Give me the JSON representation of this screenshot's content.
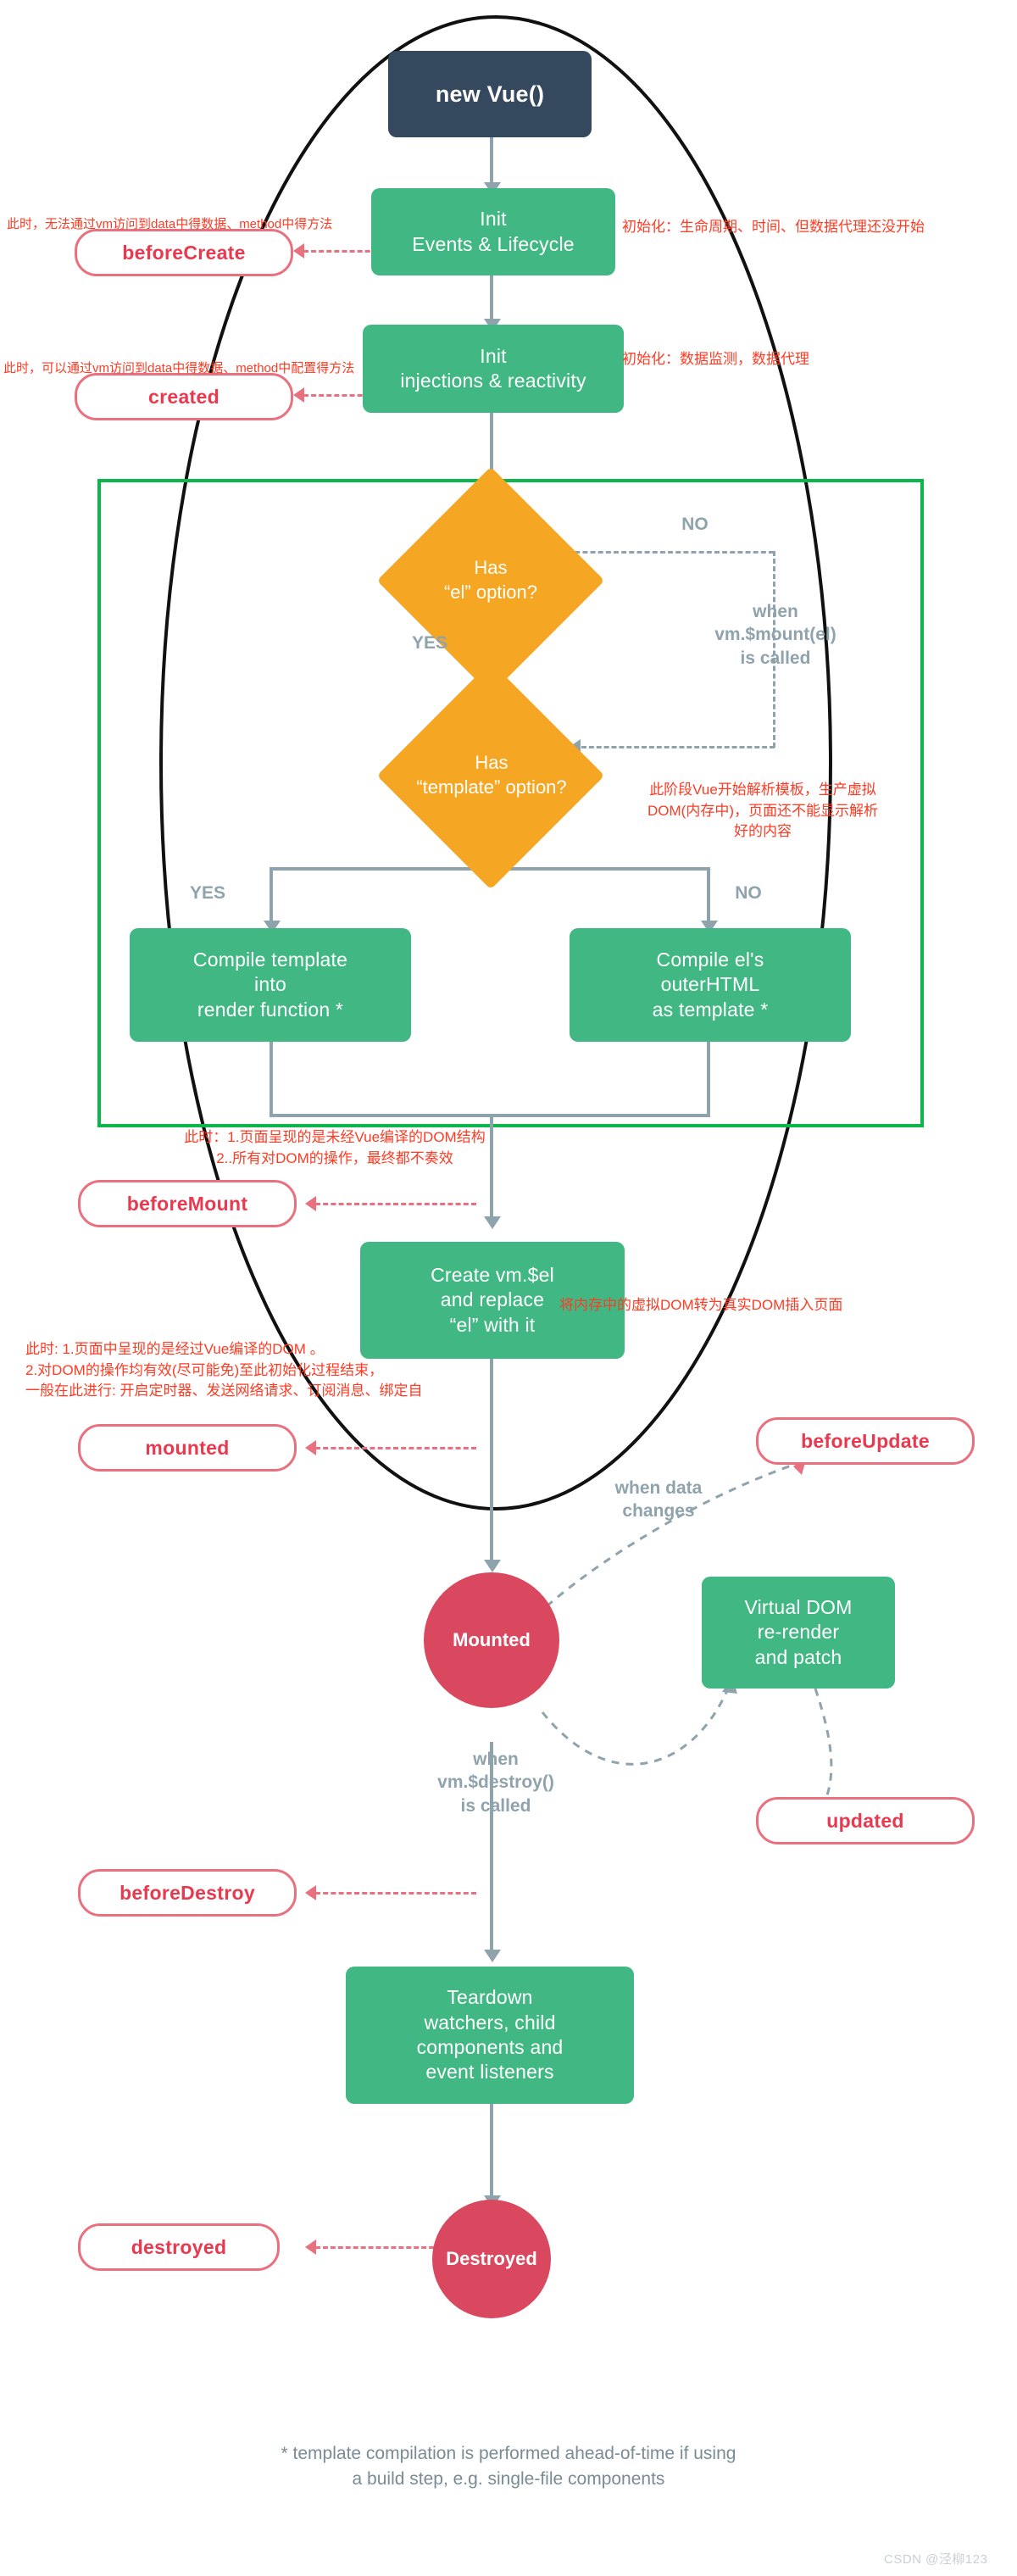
{
  "title": "Vue Lifecycle Diagram (annotated)",
  "nodes": {
    "new_vue": "new Vue()",
    "init_events": "Init\nEvents & Lifecycle",
    "init_injections": "Init\ninjections & reactivity",
    "has_el": "Has\n“el” option?",
    "has_template": "Has\n“template” option?",
    "compile_template": "Compile template\ninto\nrender function *",
    "compile_outer": "Compile el's\nouterHTML\nas template *",
    "create_vm_el": "Create vm.$el\nand replace\n“el” with it",
    "virtual_dom": "Virtual DOM\nre-render\nand patch",
    "teardown": "Teardown\nwatchers, child\ncomponents and\nevent listeners"
  },
  "circles": {
    "mounted": "Mounted",
    "destroyed": "Destroyed"
  },
  "hooks": {
    "before_create": "beforeCreate",
    "created": "created",
    "before_mount": "beforeMount",
    "mounted": "mounted",
    "before_update": "beforeUpdate",
    "updated": "updated",
    "before_destroy": "beforeDestroy",
    "destroyed": "destroyed"
  },
  "edge_labels": {
    "no_1": "NO",
    "yes_1": "YES",
    "yes_2": "YES",
    "no_2": "NO",
    "when_mount": "when\nvm.$mount(el)\nis called",
    "when_data_changes": "when data\nchanges",
    "when_destroy": "when\nvm.$destroy()\nis called"
  },
  "annotations": {
    "before_create_note": "此时，无法通过vm访问到data中得数据、method中得方法",
    "created_note": "此时，可以通过vm访问到data中得数据、method中配置得方法",
    "init_events_note": "初始化：生命周期、时间、但数据代理还没开始",
    "init_injections_note": "初始化：数据监测，数据代理",
    "template_note": "此阶段Vue开始解析模板，生产虚拟\nDOM(内存中)，页面还不能显示解析\n好的内容",
    "before_mount_note": "此时：1.页面呈现的是未经Vue编译的DOM结构\n2..所有对DOM的操作，最终都不奏效",
    "mounted_note": "此时: 1.页面中呈现的是经过Vue编译的DOM 。\n2.对DOM的操作均有效(尽可能免)至此初始化过程结束，\n一般在此进行: 开启定时器、发送网络请求、订阅消息、绑定自",
    "create_vm_note": "将内存中的虚拟DOM转为真实DOM插入页面"
  },
  "footer": {
    "note": "* template compilation is performed ahead-of-time if using\na build step, e.g. single-file components",
    "watermark": "CSDN @泾柳123"
  },
  "colors": {
    "dark": "#35495e",
    "green": "#41b883",
    "orange": "#f5a623",
    "red": "#d9485f",
    "pill_border": "#e8707f",
    "pill_text": "#e8394e",
    "connector": "#8fa3ad",
    "region": "#0bb64a",
    "annotation": "#ff3b23"
  }
}
